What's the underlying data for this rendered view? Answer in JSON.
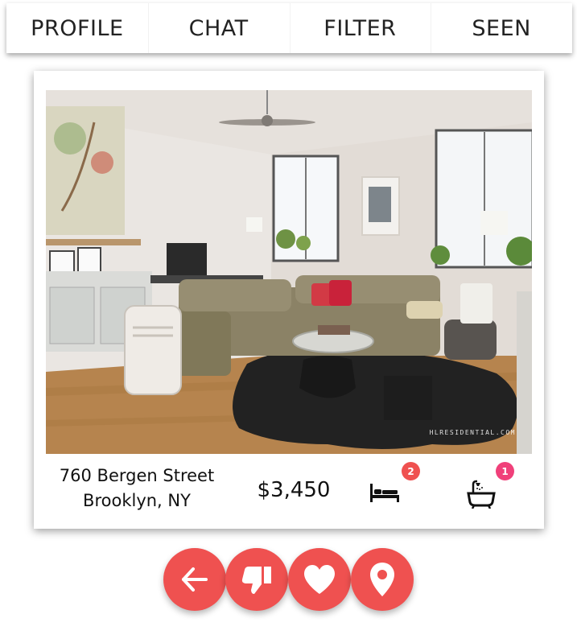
{
  "nav": {
    "tabs": [
      {
        "label": "PROFILE"
      },
      {
        "label": "CHAT"
      },
      {
        "label": "FILTER"
      },
      {
        "label": "SEEN"
      }
    ]
  },
  "listing": {
    "street": "760 Bergen Street",
    "city": "Brooklyn, NY",
    "price": "$3,450",
    "photo_watermark": "HLRESIDENTIAL.COM",
    "bedrooms": {
      "count": "2",
      "icon": "bed-icon",
      "badge_color": "#ef5150"
    },
    "bathrooms": {
      "count": "1",
      "icon": "bathtub-icon",
      "badge_color": "#f0407a"
    }
  },
  "actions": [
    {
      "name": "back",
      "icon": "arrow-left-icon"
    },
    {
      "name": "dislike",
      "icon": "thumbs-down-icon"
    },
    {
      "name": "like",
      "icon": "heart-icon"
    },
    {
      "name": "location",
      "icon": "map-pin-icon"
    }
  ],
  "colors": {
    "accent": "#ef5150",
    "bath_badge": "#f0407a"
  }
}
